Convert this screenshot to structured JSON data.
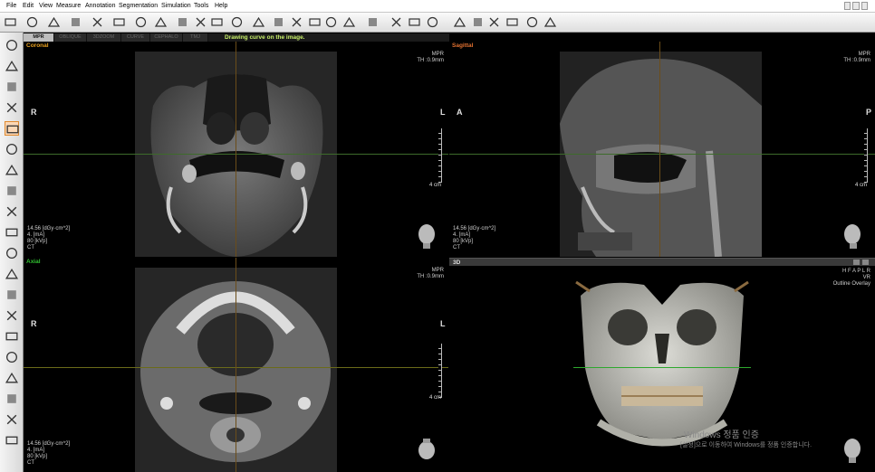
{
  "menu": [
    "File",
    "Edit",
    "View",
    "Measure",
    "Annotation",
    "Segmentation",
    "Simulation",
    "Tools",
    "Help"
  ],
  "tabs": [
    "MPR",
    "OBLIQUE",
    "3DZOOM",
    "CURVE",
    "CEPHALO",
    "TMJ"
  ],
  "hint": "Drawing curve on the image.",
  "toolbar_icons": [
    "panoramic-icon",
    "cursor-settings-icon",
    "teeth-icon",
    "eye-tracking-icon",
    "histogram-icon",
    "window-icon",
    "grid-icon",
    "bucket-icon",
    "pointer-icon",
    "text-icon",
    "pencil-icon",
    "screenshot-icon",
    "edit-icon",
    "crop-icon",
    "layers-icon",
    "save-view-icon",
    "export-icon",
    "curve-icon",
    "nerve-icon",
    "panorama-tool-icon",
    "volume-icon",
    "implant-icon",
    "image-icon",
    "person-icon",
    "ruler-icon",
    "camera-icon",
    "report-icon",
    "settings-icon"
  ],
  "left_icons": [
    "new-icon",
    "open-icon",
    "save-icon",
    "print-icon",
    "draw-curve-icon",
    "rotate-left-icon",
    "rotate-right-icon",
    "close-icon",
    "roll-icon",
    "move-icon",
    "brush-icon",
    "zoom-icon",
    "contrast-icon",
    "brightness-icon",
    "gradient-icon",
    "layout-icon",
    "magnify-icon",
    "reset-icon",
    "copy-icon",
    "checker-icon"
  ],
  "viewports": {
    "coronal": {
      "title": "Coronal",
      "color": "#e8a020",
      "mode": "MPR",
      "thickness": "TH :0.9mm",
      "left": "R",
      "right": "L",
      "scale": "4 cm",
      "dose": "14.56  [dGy·cm^2]",
      "ma": "4.  [mA]",
      "kvp": "80  [kVp]",
      "modality": "CT"
    },
    "sagittal": {
      "title": "Sagittal",
      "color": "#e07030",
      "mode": "MPR",
      "thickness": "TH :0.9mm",
      "left": "A",
      "right": "P",
      "scale": "4 cm",
      "dose": "14.56  [dGy·cm^2]",
      "ma": "4.  [mA]",
      "kvp": "80  [kVp]",
      "modality": "CT"
    },
    "axial": {
      "title": "Axial",
      "color": "#30c030",
      "mode": "MPR",
      "thickness": "TH :0.9mm",
      "left": "R",
      "right": "L",
      "scale": "4 cm",
      "dose": "14.56  [dGy·cm^2]",
      "ma": "4.  [mA]",
      "kvp": "80  [kVp]",
      "modality": "CT"
    },
    "vr3d": {
      "title": "3D",
      "orientation": "H F A P L R",
      "render": "VR",
      "overlay": "Outline Overlay"
    }
  },
  "watermark": {
    "line1": "Windows 정품 인증",
    "line2": "[설정]으로 이동하여 Windows를 정품 인증합니다."
  }
}
